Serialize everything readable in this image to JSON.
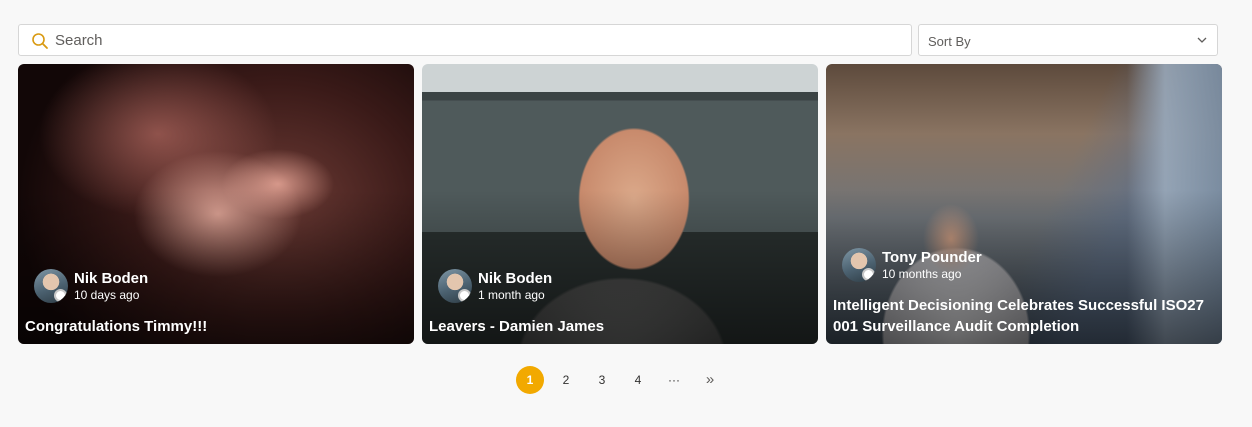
{
  "search": {
    "placeholder": "Search",
    "icon": "search-icon",
    "icon_color": "#d99a12"
  },
  "sort": {
    "label": "Sort By",
    "icon": "chevron-down-icon"
  },
  "cards": [
    {
      "author": "Nik Boden",
      "date": "10 days ago",
      "title": "Congratulations Timmy!!!"
    },
    {
      "author": "Nik Boden",
      "date": "1 month ago",
      "title": "Leavers - Damien James"
    },
    {
      "author": "Tony Pounder",
      "date": "10 months ago",
      "title": "Intelligent Decisioning Celebrates Successful ISO27001 Surveillance Audit Completion"
    }
  ],
  "pagination": {
    "pages": [
      "1",
      "2",
      "3",
      "4"
    ],
    "current": "1",
    "ellipsis": "···",
    "next": "»",
    "accent": "#f2a900"
  }
}
